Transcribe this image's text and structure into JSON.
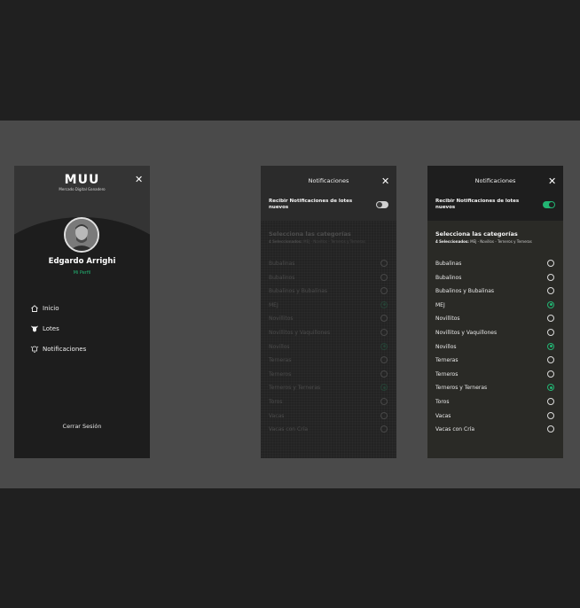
{
  "menu": {
    "logo_word": "MUU",
    "logo_sub": "Mercado Digital Ganadero",
    "user_name": "Edgardo Arrighi",
    "profile_link": "Mi Perfil",
    "nav": [
      {
        "label": "Inicio",
        "icon": "home-icon"
      },
      {
        "label": "Lotes",
        "icon": "cow-head-icon"
      },
      {
        "label": "Notificaciones",
        "icon": "bell-icon"
      }
    ],
    "logout": "Cerrar Sesión"
  },
  "notifications": {
    "title": "Notificaciones",
    "toggle_label": "Recibir Notificaciones de lotes nuevos",
    "section_title": "Selecciona las categorías",
    "summary_count": "4 Seleccionados:",
    "summary_items": "MEJ - Novillos - Terneros y Terneras",
    "options": [
      {
        "label": "Bubalinas",
        "selected": false
      },
      {
        "label": "Bubalinos",
        "selected": false
      },
      {
        "label": "Bubalinos y Bubalinas",
        "selected": false
      },
      {
        "label": "MEJ",
        "selected": true
      },
      {
        "label": "Novillitos",
        "selected": false
      },
      {
        "label": "Novillitos y Vaquillones",
        "selected": false
      },
      {
        "label": "Novillos",
        "selected": true
      },
      {
        "label": "Terneras",
        "selected": false
      },
      {
        "label": "Terneros",
        "selected": false
      },
      {
        "label": "Terneros y Terneras",
        "selected": true
      },
      {
        "label": "Toros",
        "selected": false
      },
      {
        "label": "Vacas",
        "selected": false
      },
      {
        "label": "Vacas con Cría",
        "selected": false
      }
    ]
  },
  "colors": {
    "accent": "#22b573",
    "screen_bg": "#1d1d1d",
    "band_bg": "#4a4a4a",
    "page_bg": "#202020"
  }
}
